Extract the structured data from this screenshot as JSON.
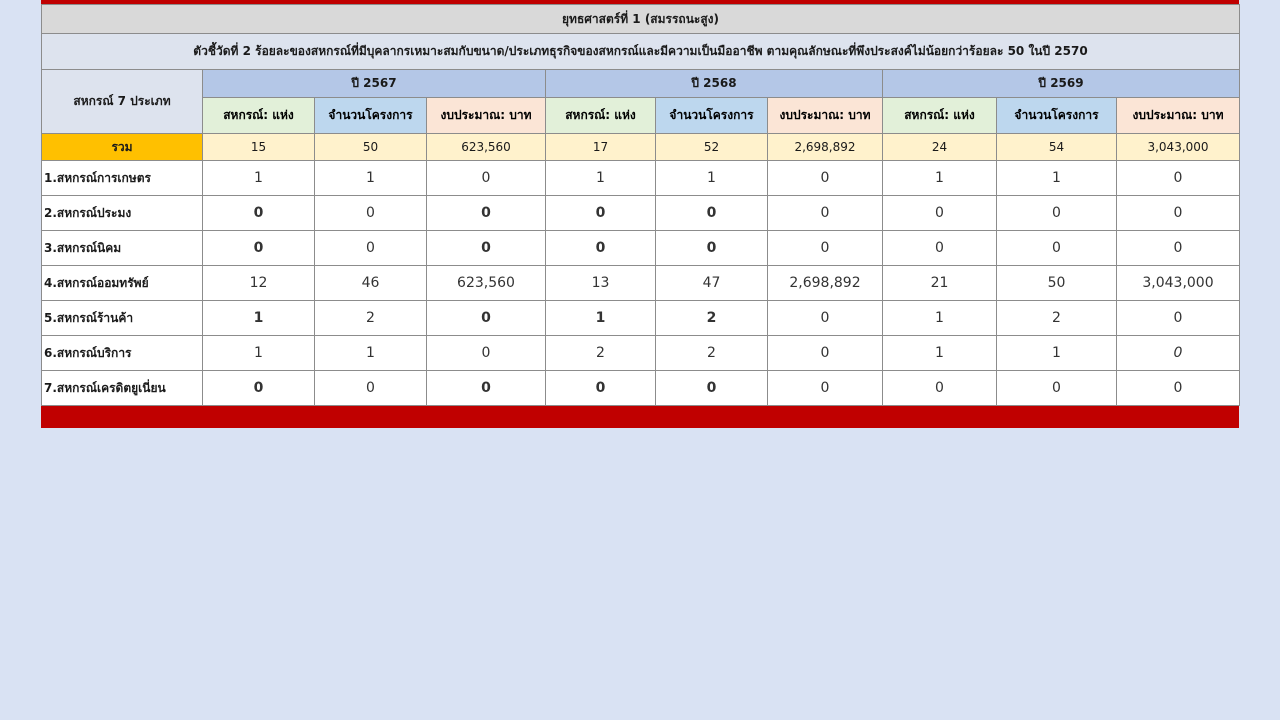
{
  "title": "ยุทธศาสตร์ที่ 1 (สมรรถนะสูง)",
  "subtitle": "ตัวชี้วัดที่ 2 ร้อยละของสหกรณ์ที่มีบุคลากรเหมาะสมกับขนาด/ประเภทธุรกิจของสหกรณ์และมีความเป็นมืออาชีพ ตามคุณลักษณะที่พึงประสงค์ไม่น้อยกว่าร้อยละ 50 ในปี 2570",
  "category_header": "สหกรณ์ 7 ประเภท",
  "years": [
    "ปี 2567",
    "ปี 2568",
    "ปี 2569"
  ],
  "columns": [
    "สหกรณ์: แห่ง",
    "จำนวนโครงการ",
    "งบประมาณ: บาท"
  ],
  "total": {
    "label": "รวม",
    "values": [
      "15",
      "50",
      "623,560",
      "17",
      "52",
      "2,698,892",
      "24",
      "54",
      "3,043,000"
    ]
  },
  "rows": [
    {
      "label": "1.สหกรณ์การเกษตร",
      "values": [
        "1",
        "1",
        "0",
        "1",
        "1",
        "0",
        "1",
        "1",
        "0"
      ]
    },
    {
      "label": "2.สหกรณ์ประมง",
      "values": [
        "0",
        "0",
        "0",
        "0",
        "0",
        "0",
        "0",
        "0",
        "0"
      ]
    },
    {
      "label": "3.สหกรณ์นิคม",
      "values": [
        "0",
        "0",
        "0",
        "0",
        "0",
        "0",
        "0",
        "0",
        "0"
      ]
    },
    {
      "label": "4.สหกรณ์ออมทรัพย์",
      "values": [
        "12",
        "46",
        "623,560",
        "13",
        "47",
        "2,698,892",
        "21",
        "50",
        "3,043,000"
      ]
    },
    {
      "label": "5.สหกรณ์ร้านค้า",
      "values": [
        "1",
        "2",
        "0",
        "1",
        "2",
        "0",
        "1",
        "2",
        "0"
      ]
    },
    {
      "label": "6.สหกรณ์บริการ",
      "values": [
        "1",
        "1",
        "0",
        "2",
        "2",
        "0",
        "1",
        "1",
        "0"
      ]
    },
    {
      "label": "7.สหกรณ์เครดิตยูเนี่ยน",
      "values": [
        "0",
        "0",
        "0",
        "0",
        "0",
        "0",
        "0",
        "0",
        "0"
      ]
    }
  ],
  "colors": {
    "accent_bar": "#c00000",
    "total_label_bg": "#ffc000",
    "total_row_bg": "#fff2cc",
    "year_header_bg": "#b4c7e7",
    "page_bg": "#d9e2f3"
  }
}
